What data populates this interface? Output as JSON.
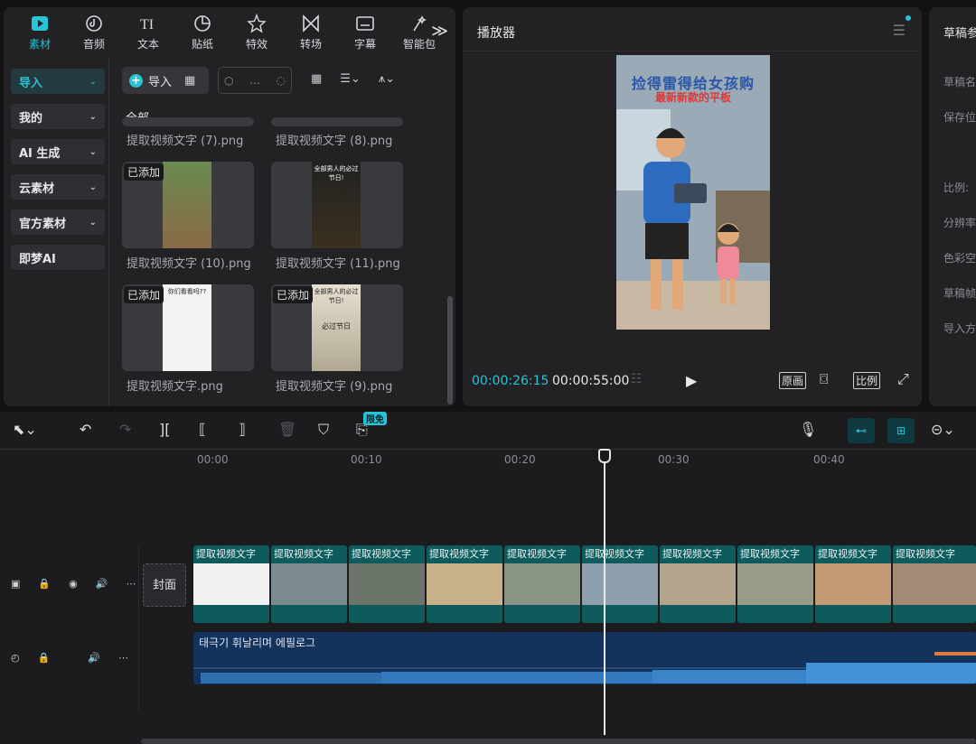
{
  "toolbar": {
    "tabs": [
      {
        "label": "素材",
        "icon": "media-icon"
      },
      {
        "label": "音频",
        "icon": "music-icon"
      },
      {
        "label": "文本",
        "icon": "text-icon"
      },
      {
        "label": "贴纸",
        "icon": "sticker-icon"
      },
      {
        "label": "特效",
        "icon": "effects-icon"
      },
      {
        "label": "转场",
        "icon": "transition-icon"
      },
      {
        "label": "字幕",
        "icon": "subtitle-icon"
      },
      {
        "label": "智能包",
        "icon": "smart-icon"
      }
    ],
    "more": "≫"
  },
  "sidebar": {
    "items": [
      {
        "label": "导入"
      },
      {
        "label": "我的"
      },
      {
        "label": "AI 生成"
      },
      {
        "label": "云素材"
      },
      {
        "label": "官方素材"
      },
      {
        "label": "即梦AI"
      }
    ]
  },
  "media": {
    "import_label": "导入",
    "search_placeholder": "...",
    "section_title": "全部",
    "added_badge": "已添加",
    "captions": [
      "提取视频文字 (7).png",
      "提取视频文字 (8).png",
      "提取视频文字 (10).png",
      "提取视频文字 (11).png",
      "提取视频文字.png",
      "提取视频文字 (9).png"
    ],
    "thumb_texts": [
      "全部男人的必过节日!",
      "你们看看吗??",
      "必过节日"
    ]
  },
  "player": {
    "title": "播放器",
    "preview_title": "捡得雷得给女孩购",
    "preview_subtitle": "最新新款的平板",
    "current_time": "00:00:26:15",
    "total_time": "00:00:55:00",
    "btn_original": "原画",
    "btn_ratio": "比例"
  },
  "draft": {
    "title": "草稿参数",
    "labels": [
      "草稿名",
      "保存位",
      "比例:",
      "分辨率",
      "色彩空",
      "草稿帧",
      "导入方"
    ]
  },
  "timeline": {
    "free_badge": "限免",
    "ruler": [
      "00:00",
      "00:10",
      "00:20",
      "00:30",
      "00:40"
    ],
    "cover_label": "封面",
    "clip_label": "提取视频文字",
    "audio_label": "태극기 휘날리며 에필로그"
  },
  "colors": {
    "accent": "#27c3d6",
    "clip": "#0d5b5c",
    "audio": "#13335c"
  }
}
